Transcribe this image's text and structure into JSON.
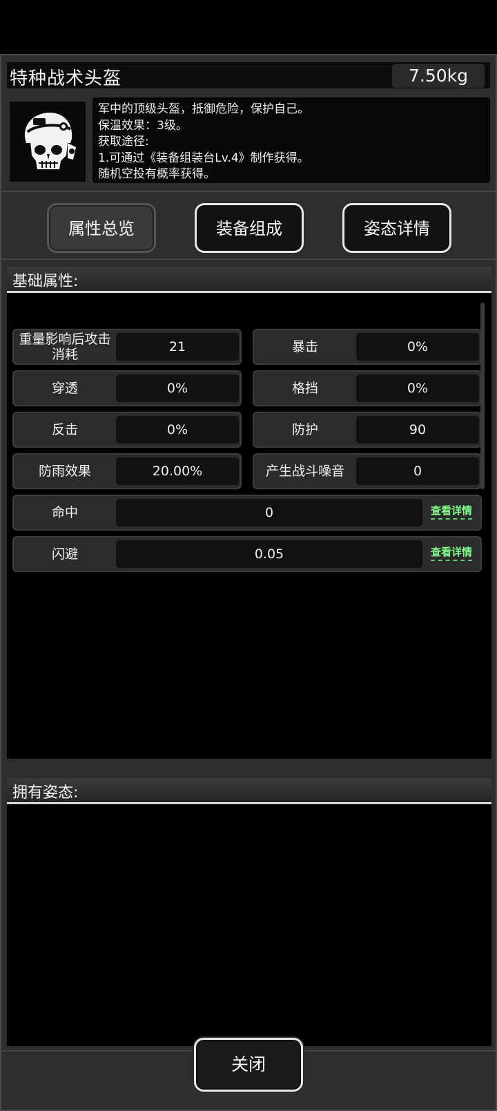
{
  "item": {
    "name": "特种战术头盔",
    "weight": "7.50kg",
    "description": [
      "军中的顶级头盔，抵御危险，保护自己。",
      "保温效果：3级。",
      "获取途径:",
      "1.可通过《装备组装台Lv.4》制作获得。",
      "随机空投有概率获得。"
    ],
    "icon": "helmet-skull-icon"
  },
  "tabs": [
    {
      "label": "属性总览",
      "active": true
    },
    {
      "label": "装备组成",
      "active": false
    },
    {
      "label": "姿态详情",
      "active": false
    }
  ],
  "basic": {
    "title": "基础属性:",
    "stats": [
      {
        "label": "重量影响后攻击消耗",
        "value": "21"
      },
      {
        "label": "暴击",
        "value": "0%"
      },
      {
        "label": "穿透",
        "value": "0%"
      },
      {
        "label": "格挡",
        "value": "0%"
      },
      {
        "label": "反击",
        "value": "0%"
      },
      {
        "label": "防护",
        "value": "90"
      },
      {
        "label": "防雨效果",
        "value": "20.00%"
      },
      {
        "label": "产生战斗噪音",
        "value": "0"
      }
    ],
    "wide_stats": [
      {
        "label": "命中",
        "value": "0",
        "link": "查看详情"
      },
      {
        "label": "闪避",
        "value": "0.05",
        "link": "查看详情"
      }
    ]
  },
  "stances": {
    "title": "拥有姿态:"
  },
  "close_label": "关闭",
  "colors": {
    "link": "#7dff8a",
    "background": "#000000",
    "panel": "#2e2e2e"
  }
}
